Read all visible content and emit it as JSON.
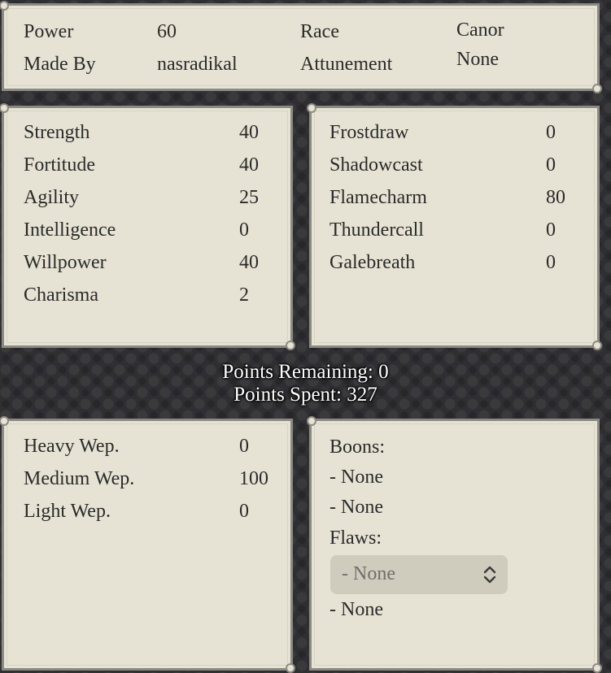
{
  "info": {
    "power_label": "Power",
    "power_value": "60",
    "race_label": "Race",
    "race_value": "Canor",
    "madeby_label": "Made By",
    "madeby_value": "nasradikal",
    "attunement_label": "Attunement",
    "attunement_value": "None"
  },
  "attributes": [
    {
      "label": "Strength",
      "value": "40"
    },
    {
      "label": "Fortitude",
      "value": "40"
    },
    {
      "label": "Agility",
      "value": "25"
    },
    {
      "label": "Intelligence",
      "value": "0"
    },
    {
      "label": "Willpower",
      "value": "40"
    },
    {
      "label": "Charisma",
      "value": "2"
    }
  ],
  "magic": [
    {
      "label": "Frostdraw",
      "value": "0"
    },
    {
      "label": "Shadowcast",
      "value": "0"
    },
    {
      "label": "Flamecharm",
      "value": "80"
    },
    {
      "label": "Thundercall",
      "value": "0"
    },
    {
      "label": "Galebreath",
      "value": "0"
    }
  ],
  "points": {
    "remaining": "Points Remaining: 0",
    "spent": "Points Spent: 327"
  },
  "weapons": [
    {
      "label": "Heavy Wep.",
      "value": "0"
    },
    {
      "label": "Medium Wep.",
      "value": "100"
    },
    {
      "label": "Light Wep.",
      "value": "0"
    }
  ],
  "boons": {
    "heading": "Boons:",
    "items": [
      "- None",
      "- None"
    ]
  },
  "flaws": {
    "heading": "Flaws:",
    "select_value": "- None",
    "item2": "- None"
  }
}
